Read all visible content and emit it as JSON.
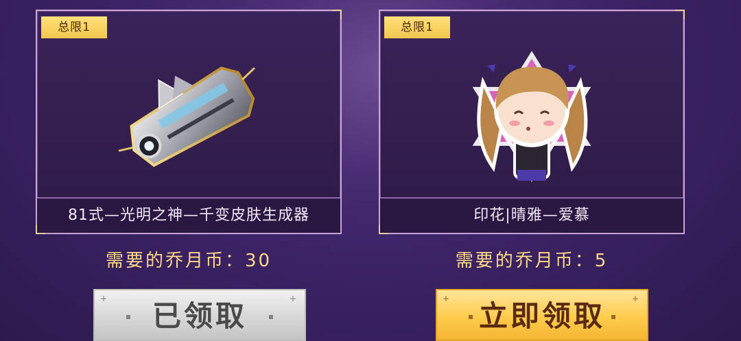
{
  "items": [
    {
      "limit_label": "总限1",
      "name": "81式—光明之神—千变皮肤生成器",
      "cost_text": "需要的乔月币：30",
      "button_label": "已领取",
      "button_state": "claimed"
    },
    {
      "limit_label": "总限1",
      "name": "印花|晴雅—爱慕",
      "cost_text": "需要的乔月币：5",
      "button_label": "立即领取",
      "button_state": "available"
    }
  ],
  "colors": {
    "background": "#3e2468",
    "card_border": "#c8a6d8",
    "limit_tag": "#f2c64c",
    "cost_text": "#ffd98a",
    "claim_button": "#ffcb4c",
    "claimed_button": "#d7d7d7"
  },
  "icons": [
    "weapon-skin-generator-icon",
    "chibi-girl-sticker-icon"
  ]
}
